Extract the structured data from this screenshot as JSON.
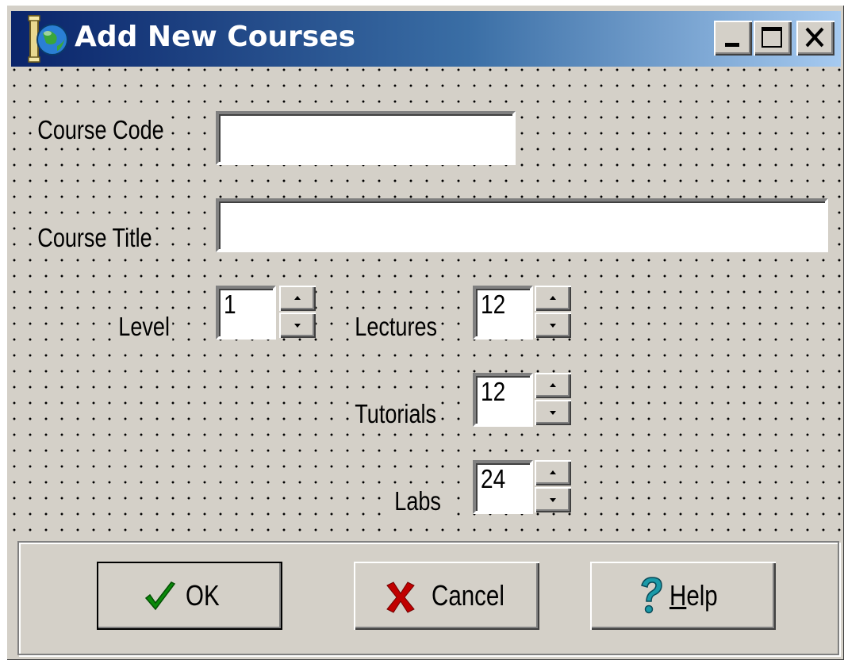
{
  "window": {
    "title": "Add New Courses",
    "controls": {
      "minimize": "_",
      "maximize": "□",
      "close": "X"
    }
  },
  "form": {
    "course_code_label": "Course Code",
    "course_code_value": "",
    "course_title_label": "Course Title",
    "course_title_value": "",
    "level_label": "Level",
    "level_value": "1",
    "lectures_label": "Lectures",
    "lectures_value": "12",
    "tutorials_label": "Tutorials",
    "tutorials_value": "12",
    "labs_label": "Labs",
    "labs_value": "24"
  },
  "buttons": {
    "ok_label": "OK",
    "cancel_label": "Cancel",
    "help_label_first": "H",
    "help_label_rest": "elp"
  },
  "icons": {
    "app": "globe-icon",
    "ok": "checkmark-icon",
    "cancel": "x-icon",
    "help": "question-mark-icon"
  },
  "colors": {
    "titlebar_start": "#0a246a",
    "titlebar_end": "#a6caf0",
    "face": "#d4d0c8",
    "ok_icon": "#0a8a0a",
    "cancel_icon": "#c00000",
    "help_icon": "#1a9aa8"
  }
}
